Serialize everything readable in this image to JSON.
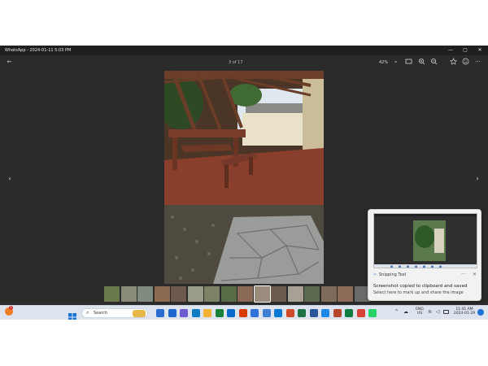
{
  "window": {
    "title": "WhatsApp - 2024-01-11 5:03 PM",
    "minimize": "—",
    "maximize": "▢",
    "close": "✕"
  },
  "viewer": {
    "counter": "3 of 17",
    "zoom": "42%",
    "zoom_chevron": "⌄",
    "back_icon": "←",
    "prev_icon": "‹",
    "next_icon": "›"
  },
  "thumbnails": {
    "colors": [
      "#6b7a4a",
      "#8a8a7a",
      "#7f8b7e",
      "#8c6b52",
      "#6d5a4c",
      "#9b9b8c",
      "#7c8266",
      "#5a6b48",
      "#8b6a55",
      "#9a8b7c",
      "#6e5b50",
      "#a7a095",
      "#5b6a4e",
      "#7e6b5a",
      "#8d6c57",
      "#6a6a6a"
    ],
    "active_index": 9
  },
  "taskbar": {
    "search_label": "Search",
    "lang_top": "ENG",
    "lang_bottom": "US",
    "time": "11:41 AM",
    "date": "2024-01-29",
    "notif_count": "1",
    "app_colors": [
      "#2b6cd2",
      "#1e66d0",
      "#6f5bd1",
      "#0e7ac4",
      "#f2b233",
      "#1a7f37",
      "#0b6bcb",
      "#d83b01",
      "#2f6fd6",
      "#3f7fd3",
      "#0078d4",
      "#d14a2a",
      "#1f7244",
      "#2b579a",
      "#1e88e5",
      "#b7472a",
      "#107c41",
      "#d64235",
      "#25d366"
    ]
  },
  "toast": {
    "app_name": "Snipping Tool",
    "more": "···",
    "close": "✕",
    "title": "Screenshot copied to clipboard and saved",
    "body": "Select here to mark up and share the image"
  }
}
